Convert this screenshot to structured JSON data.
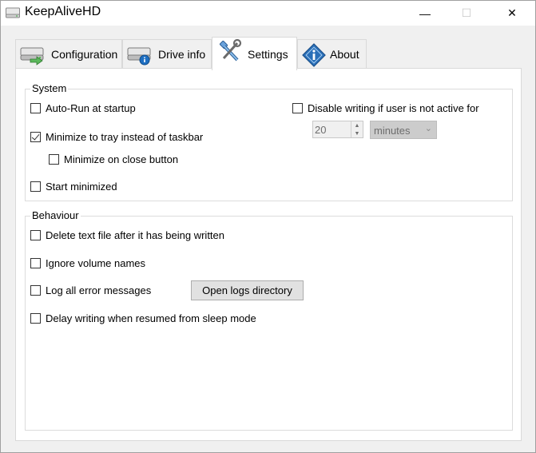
{
  "window": {
    "title": "KeepAliveHD",
    "controls": {
      "minimize": "—",
      "maximize": "☐",
      "close": "✕"
    }
  },
  "tabs": [
    {
      "label": "Configuration",
      "icon": "drive-config-icon",
      "active": false
    },
    {
      "label": "Drive info",
      "icon": "drive-info-icon",
      "active": false
    },
    {
      "label": "Settings",
      "icon": "tools-icon",
      "active": true
    },
    {
      "label": "About",
      "icon": "about-info-icon",
      "active": false
    }
  ],
  "system": {
    "title": "System",
    "auto_run": {
      "label": "Auto-Run at startup",
      "checked": false
    },
    "minimize_tray": {
      "label": "Minimize to tray instead of taskbar",
      "checked": true
    },
    "minimize_close": {
      "label": "Minimize on close button",
      "checked": false
    },
    "start_minimized": {
      "label": "Start minimized",
      "checked": false
    },
    "disable_writing": {
      "label": "Disable writing if user is not active for",
      "checked": false
    },
    "inactive_value": "20",
    "inactive_unit": "minutes"
  },
  "behaviour": {
    "title": "Behaviour",
    "delete_text": {
      "label": "Delete text file after it has being written",
      "checked": false
    },
    "ignore_volume": {
      "label": "Ignore volume names",
      "checked": false
    },
    "log_errors": {
      "label": "Log all error messages",
      "checked": false
    },
    "open_logs_button": "Open logs directory",
    "delay_writing": {
      "label": "Delay writing when resumed from sleep mode",
      "checked": false
    }
  },
  "colors": {
    "accent_blue": "#1e6fc2",
    "window_bg": "#f0f0f0",
    "panel_bg": "#ffffff"
  }
}
